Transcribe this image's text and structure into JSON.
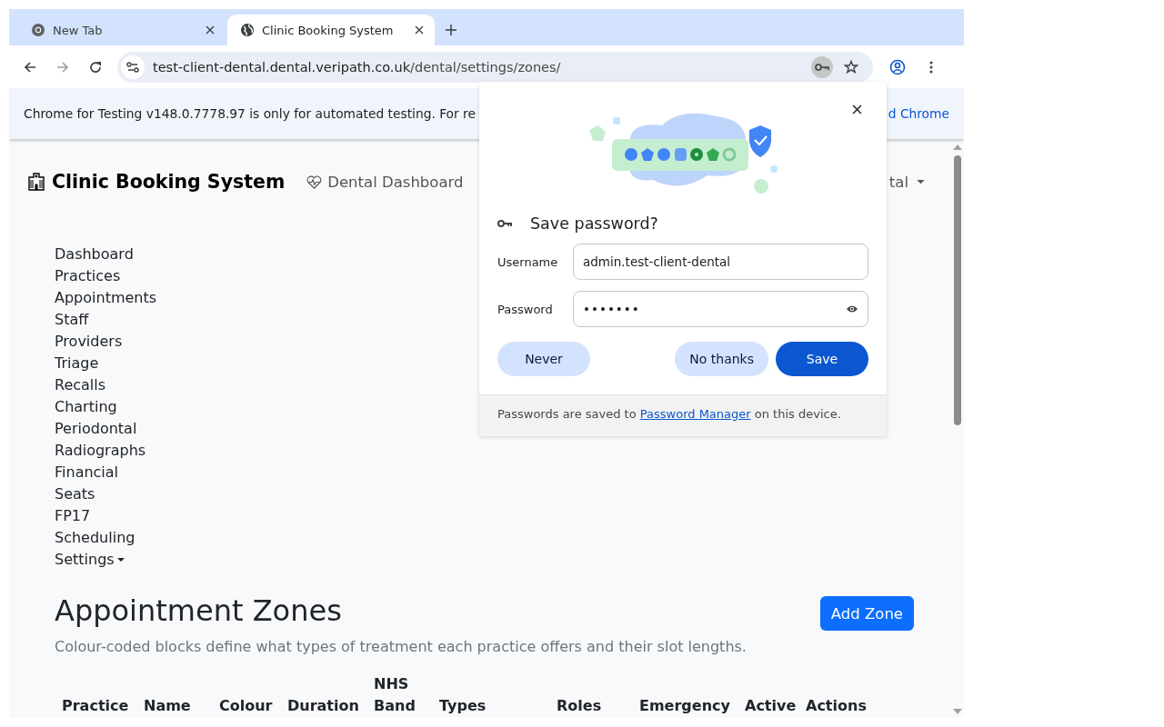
{
  "browser": {
    "tabs": [
      {
        "title": "New Tab",
        "selected": false,
        "kind": "chrome"
      },
      {
        "title": "Clinic Booking System",
        "selected": true,
        "kind": "globe"
      }
    ],
    "url_host": "test-client-dental.dental.veripath.co.uk",
    "url_path": "/dental/settings/zones/",
    "info_bar": {
      "text": "Chrome for Testing v148.0.7778.97 is only for automated testing. For re",
      "link": "d Chrome"
    }
  },
  "navbar": {
    "brand": "Clinic Booking System",
    "link": "Dental Dashboard",
    "account_menu": "tal"
  },
  "sidebar": {
    "items": [
      "Dashboard",
      "Practices",
      "Appointments",
      "Staff",
      "Providers",
      "Triage",
      "Recalls",
      "Charting",
      "Periodontal",
      "Radiographs",
      "Financial",
      "Seats",
      "FP17",
      "Scheduling"
    ],
    "dropdown": "Settings"
  },
  "page": {
    "title": "Appointment Zones",
    "description": "Colour-coded blocks define what types of treatment each practice offers and their slot lengths.",
    "add_button": "Add Zone",
    "table": {
      "columns": [
        "Practice",
        "Name",
        "Colour",
        "Duration",
        "NHS Band",
        "Types",
        "Roles",
        "Emergency",
        "Active",
        "Actions"
      ]
    }
  },
  "password_dialog": {
    "title": "Save password?",
    "username_label": "Username",
    "username": "admin.test-client-dental",
    "password_label": "Password",
    "password": "•••••••",
    "buttons": [
      {
        "label": "Never",
        "kind": "secondary"
      },
      {
        "label": "No thanks",
        "kind": "secondary"
      },
      {
        "label": "Save",
        "kind": "primary"
      }
    ],
    "footer_before": "Passwords are saved to",
    "footer_link": "Password Manager",
    "footer_after": "on this device."
  }
}
